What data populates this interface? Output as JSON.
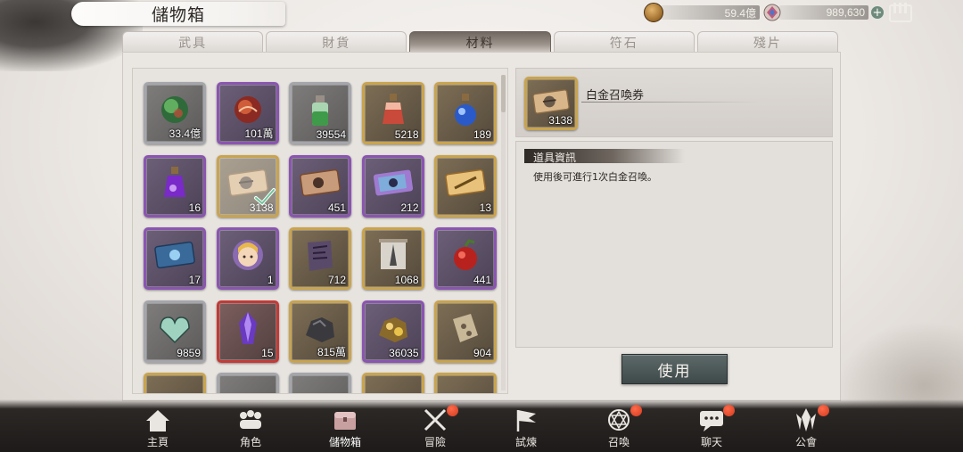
{
  "title": "儲物箱",
  "currency": {
    "gold_value": "59.4億",
    "gem_value": "989,630",
    "gold_icon": "coin-icon",
    "gem_icon": "gem-icon",
    "add_icon": "plus-icon"
  },
  "tabs": [
    {
      "label": "武具",
      "active": false
    },
    {
      "label": "財貨",
      "active": false
    },
    {
      "label": "材料",
      "active": true
    },
    {
      "label": "符石",
      "active": false
    },
    {
      "label": "殘片",
      "active": false
    }
  ],
  "items": [
    {
      "count": "33.4億",
      "rarity": "silver",
      "icon": "green-orb-icon"
    },
    {
      "count": "101萬",
      "rarity": "purple",
      "icon": "red-orb-icon"
    },
    {
      "count": "39554",
      "rarity": "silver",
      "icon": "green-potion-icon"
    },
    {
      "count": "5218",
      "rarity": "gold",
      "icon": "red-potion-icon"
    },
    {
      "count": "189",
      "rarity": "gold",
      "icon": "blue-potion-icon"
    },
    {
      "count": "16",
      "rarity": "purple",
      "icon": "purple-potion-icon"
    },
    {
      "count": "3138",
      "rarity": "gold",
      "icon": "platinum-ticket-icon",
      "selected": true
    },
    {
      "count": "451",
      "rarity": "purple",
      "icon": "bronze-ticket-icon"
    },
    {
      "count": "212",
      "rarity": "purple",
      "icon": "rainbow-ticket-icon"
    },
    {
      "count": "13",
      "rarity": "gold",
      "icon": "gold-sword-ticket-icon"
    },
    {
      "count": "17",
      "rarity": "purple",
      "icon": "blue-ticket-icon"
    },
    {
      "count": "1",
      "rarity": "purple",
      "icon": "character-portrait-icon"
    },
    {
      "count": "712",
      "rarity": "gold",
      "icon": "purple-scroll-icon"
    },
    {
      "count": "1068",
      "rarity": "gold",
      "icon": "tower-scroll-icon"
    },
    {
      "count": "441",
      "rarity": "purple",
      "icon": "red-fruit-icon"
    },
    {
      "count": "9859",
      "rarity": "silver",
      "icon": "heart-icon"
    },
    {
      "count": "15",
      "rarity": "red",
      "icon": "purple-crystal-icon"
    },
    {
      "count": "815萬",
      "rarity": "gold",
      "icon": "dark-ore-icon"
    },
    {
      "count": "36035",
      "rarity": "purple",
      "icon": "gold-ore-icon"
    },
    {
      "count": "904",
      "rarity": "gold",
      "icon": "stone-tablet-icon"
    }
  ],
  "detail": {
    "name": "白金召喚券",
    "count": "3138",
    "icon": "platinum-ticket-icon",
    "info_title": "道具資訊",
    "description": "使用後可進行1次白金召喚。",
    "use_label": "使用"
  },
  "nav": [
    {
      "label": "主頁",
      "icon": "home-icon",
      "badge": false
    },
    {
      "label": "角色",
      "icon": "party-icon",
      "badge": false
    },
    {
      "label": "儲物箱",
      "icon": "chest-icon",
      "badge": false,
      "active": true
    },
    {
      "label": "冒險",
      "icon": "crossed-swords-icon",
      "badge": true
    },
    {
      "label": "試煉",
      "icon": "flag-icon",
      "badge": false
    },
    {
      "label": "召喚",
      "icon": "summon-circle-icon",
      "badge": true
    },
    {
      "label": "聊天",
      "icon": "chat-icon",
      "badge": true
    },
    {
      "label": "公會",
      "icon": "guild-emblem-icon",
      "badge": true
    }
  ],
  "colors": {
    "gold_border": "#c9a44e",
    "purple_border": "#8a55b0",
    "silver_border": "#a4a6ab",
    "red_border": "#c33a36",
    "badge": "#e04a2a"
  }
}
